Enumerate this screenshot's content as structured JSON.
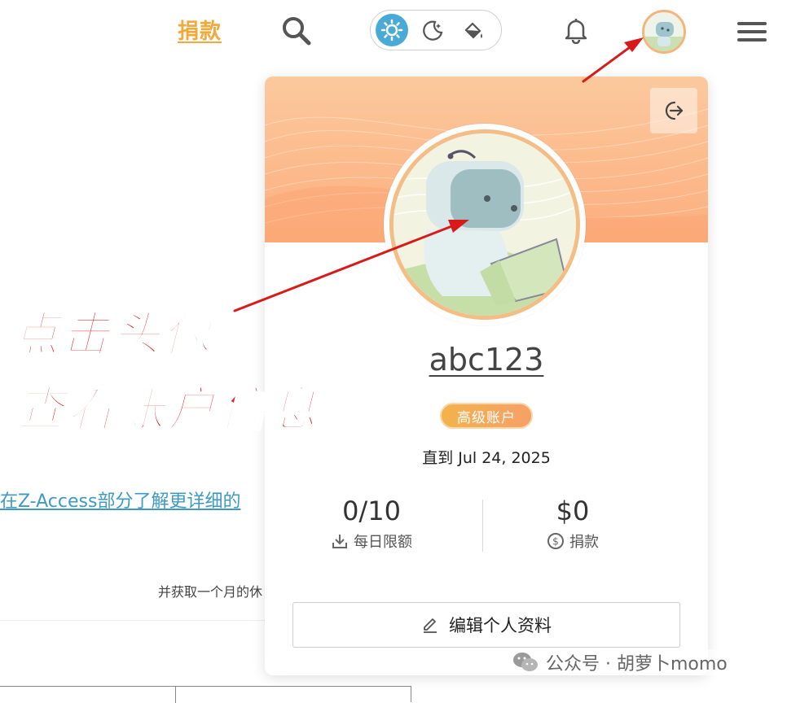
{
  "header": {
    "donate_label": "捐款",
    "theme_options": [
      "light",
      "dark",
      "paint"
    ],
    "active_theme": "light",
    "accent_color": "#4aaad6",
    "donate_color": "#f2a93b"
  },
  "background": {
    "link_text": "在Z-Access部分了解更详细的",
    "body_text": "并获取一个月的休"
  },
  "account_card": {
    "username": "abc123",
    "badge": "高级账户",
    "until_text": "直到 Jul 24, 2025",
    "stats": {
      "daily_limit": {
        "value": "0/10",
        "label": "每日限额"
      },
      "donations": {
        "value": "$0",
        "label": "捐款"
      }
    },
    "edit_profile_label": "编辑个人资料",
    "banner_color": "#fcae7d"
  },
  "annotation": {
    "line1": "点击头像",
    "line2": "查看账户信息",
    "color": "#e31c1c"
  },
  "watermark": {
    "text": "公众号 · 胡萝卜momo"
  }
}
